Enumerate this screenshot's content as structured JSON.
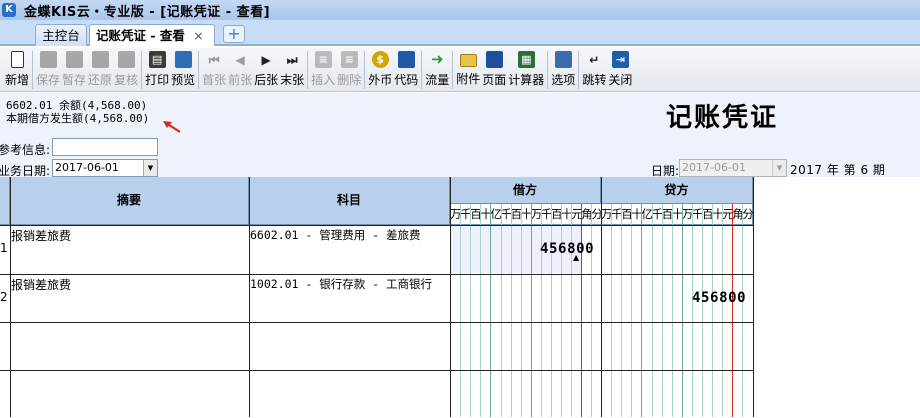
{
  "window": {
    "app_icon_text": "K",
    "title": "金蝶KIS云・专业版 - [记账凭证 - 查看]"
  },
  "tabs": [
    {
      "label": "主控台"
    },
    {
      "label": "记账凭证 - 查看",
      "close": "×"
    }
  ],
  "new_tab_glyph": "+",
  "toolbar": {
    "buttons": [
      {
        "label": "新增",
        "icon": "new-file-icon",
        "enabled": true
      },
      {
        "label": "保存",
        "icon": "save-icon",
        "enabled": false
      },
      {
        "label": "暂存",
        "icon": "temp-save-icon",
        "enabled": false
      },
      {
        "label": "还原",
        "icon": "restore-icon",
        "enabled": false
      },
      {
        "label": "复核",
        "icon": "review-icon",
        "enabled": false
      },
      {
        "label": "打印",
        "icon": "print-icon",
        "enabled": true
      },
      {
        "label": "预览",
        "icon": "preview-icon",
        "enabled": true
      },
      {
        "label": "首张",
        "icon": "first-icon",
        "enabled": false
      },
      {
        "label": "前张",
        "icon": "prev-icon",
        "enabled": false
      },
      {
        "label": "后张",
        "icon": "next-icon",
        "enabled": true
      },
      {
        "label": "末张",
        "icon": "last-icon",
        "enabled": true
      },
      {
        "label": "插入",
        "icon": "insert-row-icon",
        "enabled": false
      },
      {
        "label": "删除",
        "icon": "delete-row-icon",
        "enabled": false
      },
      {
        "label": "外币",
        "icon": "currency-icon",
        "enabled": true
      },
      {
        "label": "代码",
        "icon": "code-icon",
        "enabled": true
      },
      {
        "label": "流量",
        "icon": "cashflow-icon",
        "enabled": true
      },
      {
        "label": "附件",
        "icon": "attachment-icon",
        "enabled": true
      },
      {
        "label": "页面",
        "icon": "page-icon",
        "enabled": true
      },
      {
        "label": "计算器",
        "icon": "calculator-icon",
        "enabled": true
      },
      {
        "label": "选项",
        "icon": "options-icon",
        "enabled": true
      },
      {
        "label": "跳转",
        "icon": "jump-icon",
        "enabled": true
      },
      {
        "label": "关闭",
        "icon": "exit-icon",
        "enabled": true
      }
    ]
  },
  "info": {
    "balance_line1": "6602.01 余额(4,568.00)",
    "balance_line2": "本期借方发生额(4,568.00)"
  },
  "voucher_title": "记账凭证",
  "ref_label": "参考信息:",
  "ref_value": "",
  "biz_date_label": "业务日期:",
  "biz_date": "2017-06-01",
  "date_label": "日期:",
  "date": "2017-06-01",
  "period_text": "2017 年 第 6 期",
  "grid": {
    "headers": {
      "summary": "摘要",
      "account": "科目",
      "debit": "借方",
      "credit": "贷方"
    },
    "debit_digits": [
      "万",
      "千",
      "百",
      "十",
      "亿",
      "千",
      "百",
      "十",
      "万",
      "千",
      "百",
      "十",
      "元",
      "角",
      "分"
    ],
    "credit_digits": [
      "万",
      "千",
      "百",
      "十",
      "亿",
      "千",
      "百",
      "十",
      "万",
      "千",
      "百",
      "十",
      "元",
      "角",
      "分"
    ],
    "rows": [
      {
        "no": "1",
        "summary": "报销差旅费",
        "account": "6602.01 - 管理费用 - 差旅费",
        "debit": "456800",
        "credit": ""
      },
      {
        "no": "2",
        "summary": "报销差旅费",
        "account": "1002.01 - 银行存款 - 工商银行",
        "debit": "",
        "credit": "456800"
      },
      {
        "no": "",
        "summary": "",
        "account": "",
        "debit": "",
        "credit": ""
      },
      {
        "no": "",
        "summary": "",
        "account": "",
        "debit": "",
        "credit": ""
      }
    ]
  },
  "colors": {
    "header_bg": "#b8d0ec",
    "accent_red": "#e0261d",
    "selected_cell": "#eef0fb"
  }
}
